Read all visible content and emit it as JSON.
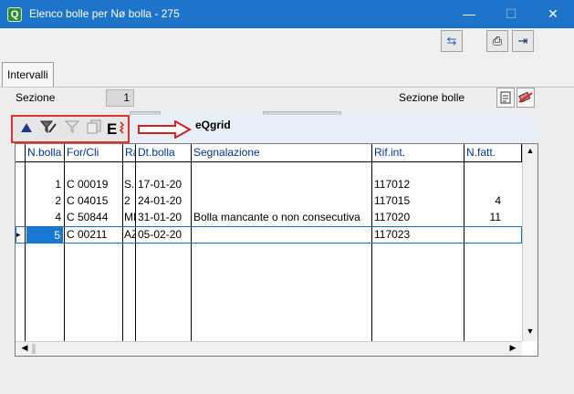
{
  "window": {
    "title": "Elenco bolle per Nø bolla - 275",
    "app_icon": "Q"
  },
  "window_controls": {
    "minimize": "—",
    "maximize": "☐",
    "close": "✕"
  },
  "toolbar": {
    "refresh_icon": "⇆",
    "print_icon": "⎙",
    "exit_icon": "⇥"
  },
  "tabs": [
    {
      "label": "Intervalli"
    }
  ],
  "filters": {
    "sezione_label": "Sezione",
    "sezione_value": "1",
    "sezione_bolle_label": "Sezione bolle"
  },
  "grid": {
    "caption": "eQgrid",
    "toolbar_icons": [
      "sort-up-icon",
      "edit-filter-icon",
      "filter-icon",
      "copy-icon",
      "export-icon"
    ],
    "columns": [
      "N.bolla",
      "For/Cli",
      "Ra",
      "Dt.bolla",
      "Segnalazione",
      "Rif.int.",
      "N.fatt."
    ],
    "rows": [
      {
        "nbolla": "",
        "forcli": "",
        "ra": "",
        "dt": "",
        "segn": "",
        "rif": "",
        "nfatt": ""
      },
      {
        "nbolla": "1",
        "forcli": "C 00019",
        "ra": "S.",
        "dt": "17-01-20",
        "segn": "",
        "rif": "117012",
        "nfatt": ""
      },
      {
        "nbolla": "2",
        "forcli": "C 04015",
        "ra": "2",
        "dt": "24-01-20",
        "segn": "",
        "rif": "117015",
        "nfatt": "4"
      },
      {
        "nbolla": "4",
        "forcli": "C 50844",
        "ra": "MI",
        "dt": "31-01-20",
        "segn": "Bolla mancante o non consecutiva",
        "rif": "117020",
        "nfatt": "11"
      },
      {
        "nbolla": "5",
        "forcli": "C 00211",
        "ra": "AZ",
        "dt": "05-02-20",
        "segn": "",
        "rif": "117023",
        "nfatt": ""
      }
    ],
    "selected_row_marker": "▸"
  },
  "colors": {
    "titlebar": "#1e74c9",
    "selection": "#1678d0",
    "header_text": "#003399",
    "highlight_border": "#e03030"
  }
}
